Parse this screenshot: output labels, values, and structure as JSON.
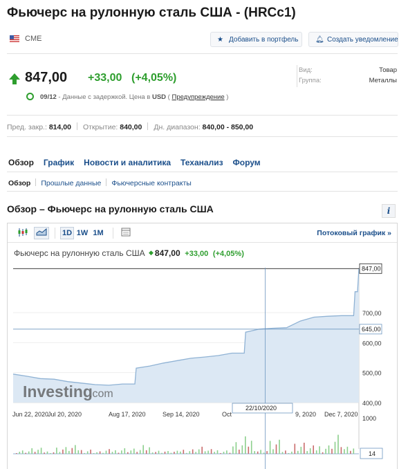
{
  "page_title": "Фьючерс на рулонную сталь США - (HRCc1)",
  "exchange": {
    "name": "CME",
    "flag": "us-flag-icon"
  },
  "actions": {
    "add_portfolio": "Добавить в портфель",
    "create_alert": "Создать уведомление"
  },
  "quote": {
    "price": "847,00",
    "change": "+33,00",
    "change_pct": "(+4,05%)",
    "date": "09/12",
    "delay_text_a": " - Данные с задержкой. Цена в ",
    "currency": "USD",
    "delay_text_b": " ( ",
    "disclaimer_link": "Предупреждение",
    "delay_text_c": " )"
  },
  "meta": {
    "type_label": "Вид:",
    "type_value": "Товар",
    "group_label": "Группа:",
    "group_value": "Металлы"
  },
  "stats": {
    "prev_close_label": "Пред. закр.:",
    "prev_close": "814,00",
    "open_label": "Открытие:",
    "open": "840,00",
    "day_range_label": "Дн. диапазон:",
    "day_range": "840,00 - 850,00"
  },
  "tabs": [
    "Обзор",
    "График",
    "Новости и аналитика",
    "Теханализ",
    "Форум"
  ],
  "subtabs": [
    "Обзор",
    "Прошлые данные",
    "Фьючерсные контракты"
  ],
  "section_title": "Обзор – Фьючерс на рулонную сталь США",
  "info_label": "i",
  "chart_toolbar": {
    "periods": [
      "1D",
      "1W",
      "1M"
    ],
    "stream_link": "Потоковый график »"
  },
  "chart_header": {
    "name": "Фьючерс на рулонную сталь США",
    "price": "847,00",
    "change": "+33,00",
    "change_pct": "(+4,05%)"
  },
  "watermark": {
    "brand": "Investing",
    "suffix": ".com"
  },
  "colors": {
    "up": "#2e9e2e",
    "link": "#1a4e8a",
    "area_fill": "#dce8f4",
    "area_line": "#8fb2d4",
    "vol_up": "#8ccf8c",
    "vol_down": "#c96b6b"
  },
  "chart_data": {
    "type": "area",
    "title": "",
    "x_ticks": [
      "Jun 22, 2020",
      "Jul 20, 2020",
      "Aug 17, 2020",
      "Sep 14, 2020",
      "Oct",
      "22/10/2020",
      "9, 2020",
      "Dec 7, 2020"
    ],
    "y_ticks": [
      "700,00",
      "600,00",
      "500,00",
      "400,00"
    ],
    "y_range": [
      400,
      850
    ],
    "price_label": "847,00",
    "crosshair_label": "645,00",
    "crosshair_date": "22/10/2020",
    "volume_ticks": [
      "1000"
    ],
    "volume_label": "14",
    "x": [
      "2020-06-15",
      "2020-06-22",
      "2020-06-29",
      "2020-07-06",
      "2020-07-13",
      "2020-07-20",
      "2020-07-27",
      "2020-08-03",
      "2020-08-10",
      "2020-08-17",
      "2020-08-24",
      "2020-08-31",
      "2020-09-07",
      "2020-09-14",
      "2020-09-21",
      "2020-09-28",
      "2020-10-05",
      "2020-10-12",
      "2020-10-19",
      "2020-10-26",
      "2020-11-02",
      "2020-11-09",
      "2020-11-16",
      "2020-11-23",
      "2020-11-30",
      "2020-12-07",
      "2020-12-09"
    ],
    "values": [
      495,
      488,
      480,
      478,
      470,
      465,
      460,
      458,
      462,
      515,
      522,
      532,
      540,
      548,
      552,
      557,
      565,
      635,
      645,
      648,
      650,
      672,
      685,
      688,
      690,
      770,
      847
    ],
    "volume": [
      120,
      180,
      90,
      220,
      260,
      150,
      80,
      140,
      200,
      170,
      260,
      110,
      90,
      160,
      230,
      140,
      120,
      380,
      520,
      140,
      420,
      130,
      360,
      250,
      300,
      620,
      210
    ]
  }
}
